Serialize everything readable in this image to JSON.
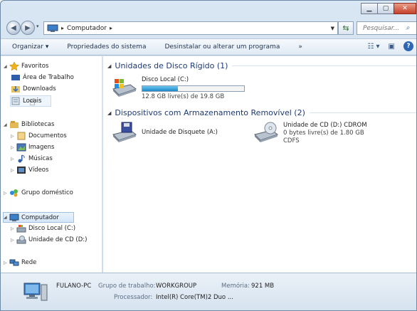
{
  "address": {
    "crumbs": [
      "Computador"
    ],
    "search_placeholder": "Pesquisar..."
  },
  "toolbar": {
    "organize": "Organizar ▾",
    "system_props": "Propriedades do sistema",
    "uninstall": "Desinstalar ou alterar um programa",
    "more": "»"
  },
  "nav": {
    "favorites": "Favoritos",
    "desktop": "Área de Trabalho",
    "downloads": "Downloads",
    "locais": "Locais",
    "libraries": "Bibliotecas",
    "documents": "Documentos",
    "images": "Imagens",
    "music": "Músicas",
    "videos": "Vídeos",
    "homegroup": "Grupo doméstico",
    "computer": "Computador",
    "local_disk": "Disco Local (C:)",
    "cd_drive": "Unidade de CD (D:)",
    "network": "Rede"
  },
  "content": {
    "hdd_group": "Unidades de Disco Rígido (1)",
    "removable_group": "Dispositivos com Armazenamento Removível (2)",
    "disk_c_name": "Disco Local (C:)",
    "disk_c_free": "12.8 GB livre(s) de 19.8 GB",
    "disk_c_used_fraction": 0.35,
    "floppy_name": "Unidade de Disquete (A:)",
    "cd_name": "Unidade de CD (D:) CDROM",
    "cd_free": "0 bytes livre(s) de 1.80 GB",
    "cd_fs": "CDFS"
  },
  "details": {
    "pc_name": "FULANO-PC",
    "workgroup_label": "Grupo de trabalho:",
    "workgroup_value": "WORKGROUP",
    "memory_label": "Memória:",
    "memory_value": "921 MB",
    "processor_label": "Processador:",
    "processor_value": "Intel(R) Core(TM)2 Duo ..."
  }
}
